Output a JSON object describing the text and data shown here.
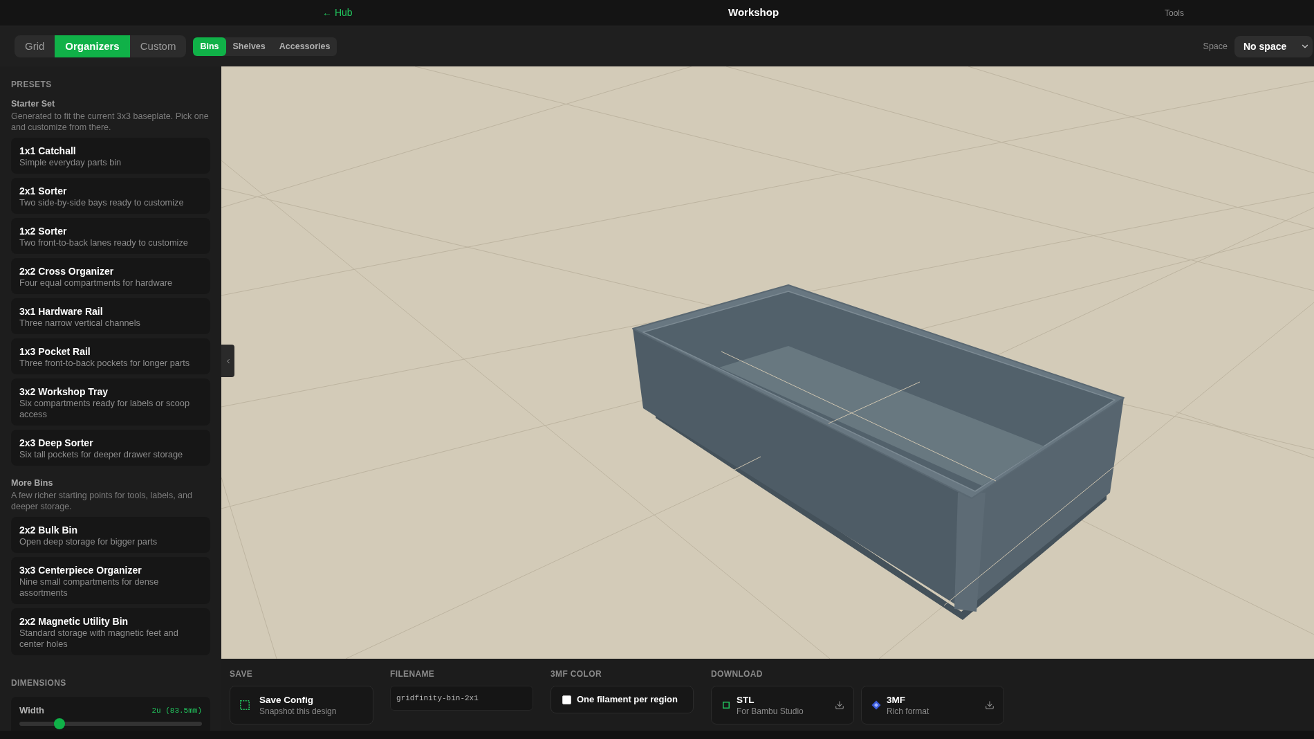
{
  "top_bar": {
    "back_link": "← Hub",
    "title": "Workshop",
    "menu": "Tools"
  },
  "mode_tabs": [
    {
      "label": "Grid",
      "selected": false
    },
    {
      "label": "Organizers",
      "selected": true
    },
    {
      "label": "Custom",
      "selected": false
    }
  ],
  "category_tabs": [
    {
      "label": "Bins",
      "selected": true
    },
    {
      "label": "Shelves",
      "selected": false
    },
    {
      "label": "Accessories",
      "selected": false
    }
  ],
  "space_select": {
    "label": "Space",
    "value": "No space"
  },
  "sidebar": {
    "presets": {
      "heading": "PRESETS",
      "groups": [
        {
          "title": "Starter Set",
          "description": "Generated to fit the current 3x3 baseplate. Pick one and customize from there.",
          "items": [
            {
              "title": "1x1 Catchall",
              "subtitle": "Simple everyday parts bin",
              "selected": false
            },
            {
              "title": "2x1 Sorter",
              "subtitle": "Two side-by-side bays ready to customize",
              "selected": false
            },
            {
              "title": "1x2 Sorter",
              "subtitle": "Two front-to-back lanes ready to customize",
              "selected": false
            },
            {
              "title": "2x2 Cross Organizer",
              "subtitle": "Four equal compartments for hardware",
              "selected": false
            },
            {
              "title": "3x1 Hardware Rail",
              "subtitle": "Three narrow vertical channels",
              "selected": false
            },
            {
              "title": "1x3 Pocket Rail",
              "subtitle": "Three front-to-back pockets for longer parts",
              "selected": false
            },
            {
              "title": "3x2 Workshop Tray",
              "subtitle": "Six compartments ready for labels or scoop access",
              "selected": false
            },
            {
              "title": "2x3 Deep Sorter",
              "subtitle": "Six tall pockets for deeper drawer storage",
              "selected": false
            }
          ]
        },
        {
          "title": "More Bins",
          "description": "A few richer starting points for tools, labels, and deeper storage.",
          "items": [
            {
              "title": "2x2 Bulk Bin",
              "subtitle": "Open deep storage for bigger parts",
              "selected": false
            },
            {
              "title": "3x3 Centerpiece Organizer",
              "subtitle": "Nine small compartments for dense assortments",
              "selected": false
            },
            {
              "title": "2x2 Magnetic Utility Bin",
              "subtitle": "Standard storage with magnetic feet and center holes",
              "selected": false
            }
          ]
        }
      ]
    },
    "dimensions": {
      "heading": "DIMENSIONS",
      "sliders": [
        {
          "label": "Width",
          "reading": "2u (83.5mm)",
          "level": 0.22
        }
      ]
    }
  },
  "bottom_panel": {
    "save": {
      "heading": "SAVE",
      "title": "Save Config",
      "subtitle": "Snapshot this design"
    },
    "filename": {
      "heading": "FILENAME",
      "value": "gridfinity-bin-2x1"
    },
    "color_option": {
      "heading": "3MF COLOR",
      "label": "One filament per region",
      "checked": false
    },
    "download": {
      "heading": "DOWNLOAD",
      "options": [
        {
          "kind": "square",
          "title": "STL",
          "subtitle": "For Bambu Studio"
        },
        {
          "kind": "diamond",
          "title": "3MF",
          "subtitle": "Rich format"
        }
      ]
    }
  }
}
